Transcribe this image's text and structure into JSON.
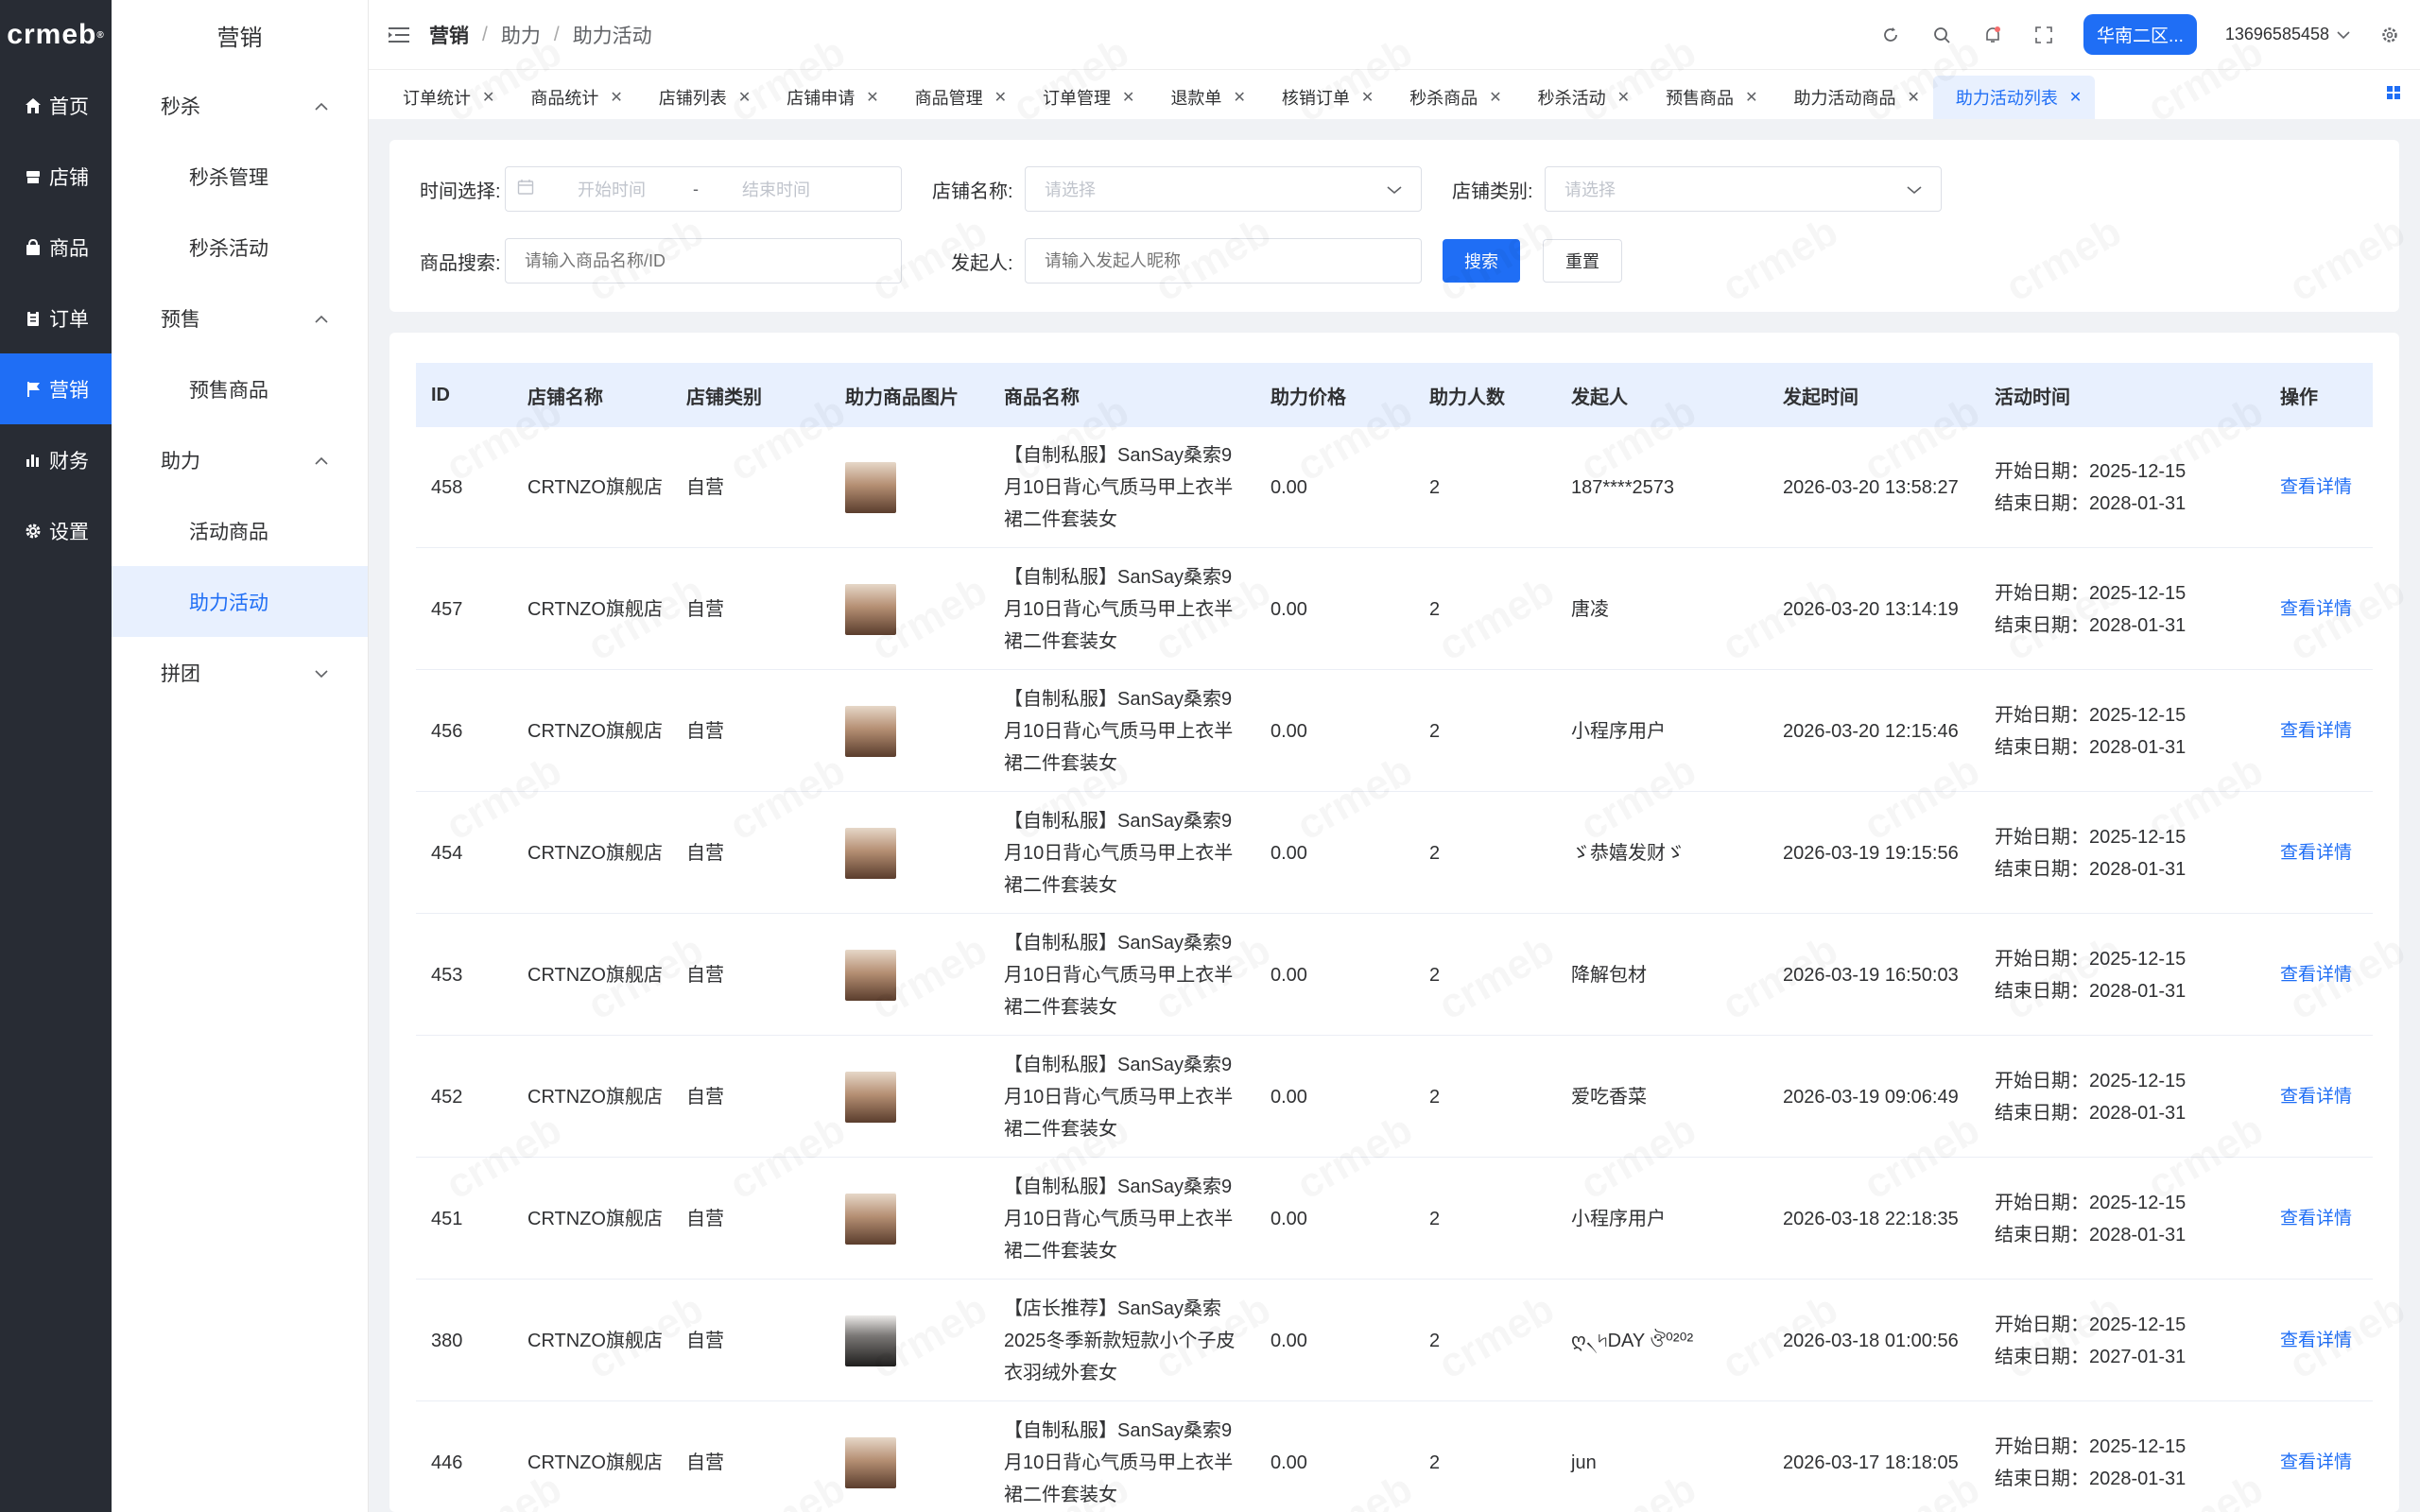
{
  "nav": {
    "logo": "crmeb",
    "items": [
      {
        "label": "首页",
        "icon": "home-icon"
      },
      {
        "label": "店铺",
        "icon": "store-icon"
      },
      {
        "label": "商品",
        "icon": "bag-icon"
      },
      {
        "label": "订单",
        "icon": "clipboard-icon"
      },
      {
        "label": "营销",
        "icon": "flag-icon"
      },
      {
        "label": "财务",
        "icon": "bar-chart-icon"
      },
      {
        "label": "设置",
        "icon": "gear-icon"
      }
    ]
  },
  "submenu": {
    "title": "营销",
    "groups": [
      {
        "label": "秒杀",
        "items": [
          "秒杀管理",
          "秒杀活动"
        ]
      },
      {
        "label": "预售",
        "items": [
          "预售商品"
        ]
      },
      {
        "label": "助力",
        "items": [
          "活动商品",
          "助力活动"
        ]
      },
      {
        "label": "拼团",
        "items": []
      }
    ]
  },
  "header": {
    "crumbs": [
      "营销",
      "助力",
      "助力活动"
    ],
    "region": "华南二区...",
    "phone": "13696585458"
  },
  "tabs": [
    "订单统计",
    "商品统计",
    "店铺列表",
    "店铺申请",
    "商品管理",
    "订单管理",
    "退款单",
    "核销订单",
    "秒杀商品",
    "秒杀活动",
    "预售商品",
    "助力活动商品",
    "助力活动列表"
  ],
  "filter": {
    "time_label": "时间选择:",
    "start_placeholder": "开始时间",
    "dash": "-",
    "end_placeholder": "结束时间",
    "store_label": "店铺名称:",
    "store_placeholder": "请选择",
    "type_label": "店铺类别:",
    "type_placeholder": "请选择",
    "search_label": "商品搜索:",
    "search_placeholder": "请输入商品名称/ID",
    "initiator_label": "发起人:",
    "initiator_placeholder": "请输入发起人昵称",
    "search_button": "搜索",
    "reset_button": "重置"
  },
  "table": {
    "columns": [
      "ID",
      "店铺名称",
      "店铺类别",
      "助力商品图片",
      "商品名称",
      "助力价格",
      "助力人数",
      "发起人",
      "发起时间",
      "活动时间",
      "操作"
    ],
    "rows": [
      {
        "id": "458",
        "store": "CRTNZO旗舰店",
        "type": "自营",
        "name": "【自制私服】SanSay桑索9月10日背心气质马甲上衣半裙二件套装女",
        "price": "0.00",
        "count": "2",
        "initiator": "187****2573",
        "time": "2026-03-20 13:58:27",
        "start": "开始日期：2025-12-15",
        "end": "结束日期：2028-01-31",
        "action": "查看详情"
      },
      {
        "id": "457",
        "store": "CRTNZO旗舰店",
        "type": "自营",
        "name": "【自制私服】SanSay桑索9月10日背心气质马甲上衣半裙二件套装女",
        "price": "0.00",
        "count": "2",
        "initiator": "唐凌",
        "time": "2026-03-20 13:14:19",
        "start": "开始日期：2025-12-15",
        "end": "结束日期：2028-01-31",
        "action": "查看详情"
      },
      {
        "id": "456",
        "store": "CRTNZO旗舰店",
        "type": "自营",
        "name": "【自制私服】SanSay桑索9月10日背心气质马甲上衣半裙二件套装女",
        "price": "0.00",
        "count": "2",
        "initiator": "小程序用户",
        "time": "2026-03-20 12:15:46",
        "start": "开始日期：2025-12-15",
        "end": "结束日期：2028-01-31",
        "action": "查看详情"
      },
      {
        "id": "454",
        "store": "CRTNZO旗舰店",
        "type": "自营",
        "name": "【自制私服】SanSay桑索9月10日背心气质马甲上衣半裙二件套装女",
        "price": "0.00",
        "count": "2",
        "initiator": "ゞ恭嬉发财ゞ",
        "time": "2026-03-19 19:15:56",
        "start": "开始日期：2025-12-15",
        "end": "结束日期：2028-01-31",
        "action": "查看详情"
      },
      {
        "id": "453",
        "store": "CRTNZO旗舰店",
        "type": "自营",
        "name": "【自制私服】SanSay桑索9月10日背心气质马甲上衣半裙二件套装女",
        "price": "0.00",
        "count": "2",
        "initiator": "降解包材",
        "time": "2026-03-19 16:50:03",
        "start": "开始日期：2025-12-15",
        "end": "结束日期：2028-01-31",
        "action": "查看详情"
      },
      {
        "id": "452",
        "store": "CRTNZO旗舰店",
        "type": "自营",
        "name": "【自制私服】SanSay桑索9月10日背心气质马甲上衣半裙二件套装女",
        "price": "0.00",
        "count": "2",
        "initiator": "爱吃香菜",
        "time": "2026-03-19 09:06:49",
        "start": "开始日期：2025-12-15",
        "end": "结束日期：2028-01-31",
        "action": "查看详情"
      },
      {
        "id": "451",
        "store": "CRTNZO旗舰店",
        "type": "自营",
        "name": "【自制私服】SanSay桑索9月10日背心气质马甲上衣半裙二件套装女",
        "price": "0.00",
        "count": "2",
        "initiator": "小程序用户",
        "time": "2026-03-18 22:18:35",
        "start": "开始日期：2025-12-15",
        "end": "结束日期：2028-01-31",
        "action": "查看详情"
      },
      {
        "id": "380",
        "store": "CRTNZO旗舰店",
        "type": "自营",
        "name": "【店长推荐】SanSay桑索2025冬季新款短款小个子皮衣羽绒外套女",
        "price": "0.00",
        "count": "2",
        "initiator": "ღ৲৸DAY ঔ⁰²⁰²",
        "time": "2026-03-18 01:00:56",
        "start": "开始日期：2025-12-15",
        "end": "结束日期：2027-01-31",
        "action": "查看详情"
      },
      {
        "id": "446",
        "store": "CRTNZO旗舰店",
        "type": "自营",
        "name": "【自制私服】SanSay桑索9月10日背心气质马甲上衣半裙二件套装女",
        "price": "0.00",
        "count": "2",
        "initiator": "jun",
        "time": "2026-03-17 18:18:05",
        "start": "开始日期：2025-12-15",
        "end": "结束日期：2028-01-31",
        "action": "查看详情"
      }
    ]
  },
  "colors": {
    "primary": "#1f6ef5",
    "nav_bg": "#282c34",
    "header_row": "#e8f0fe"
  }
}
